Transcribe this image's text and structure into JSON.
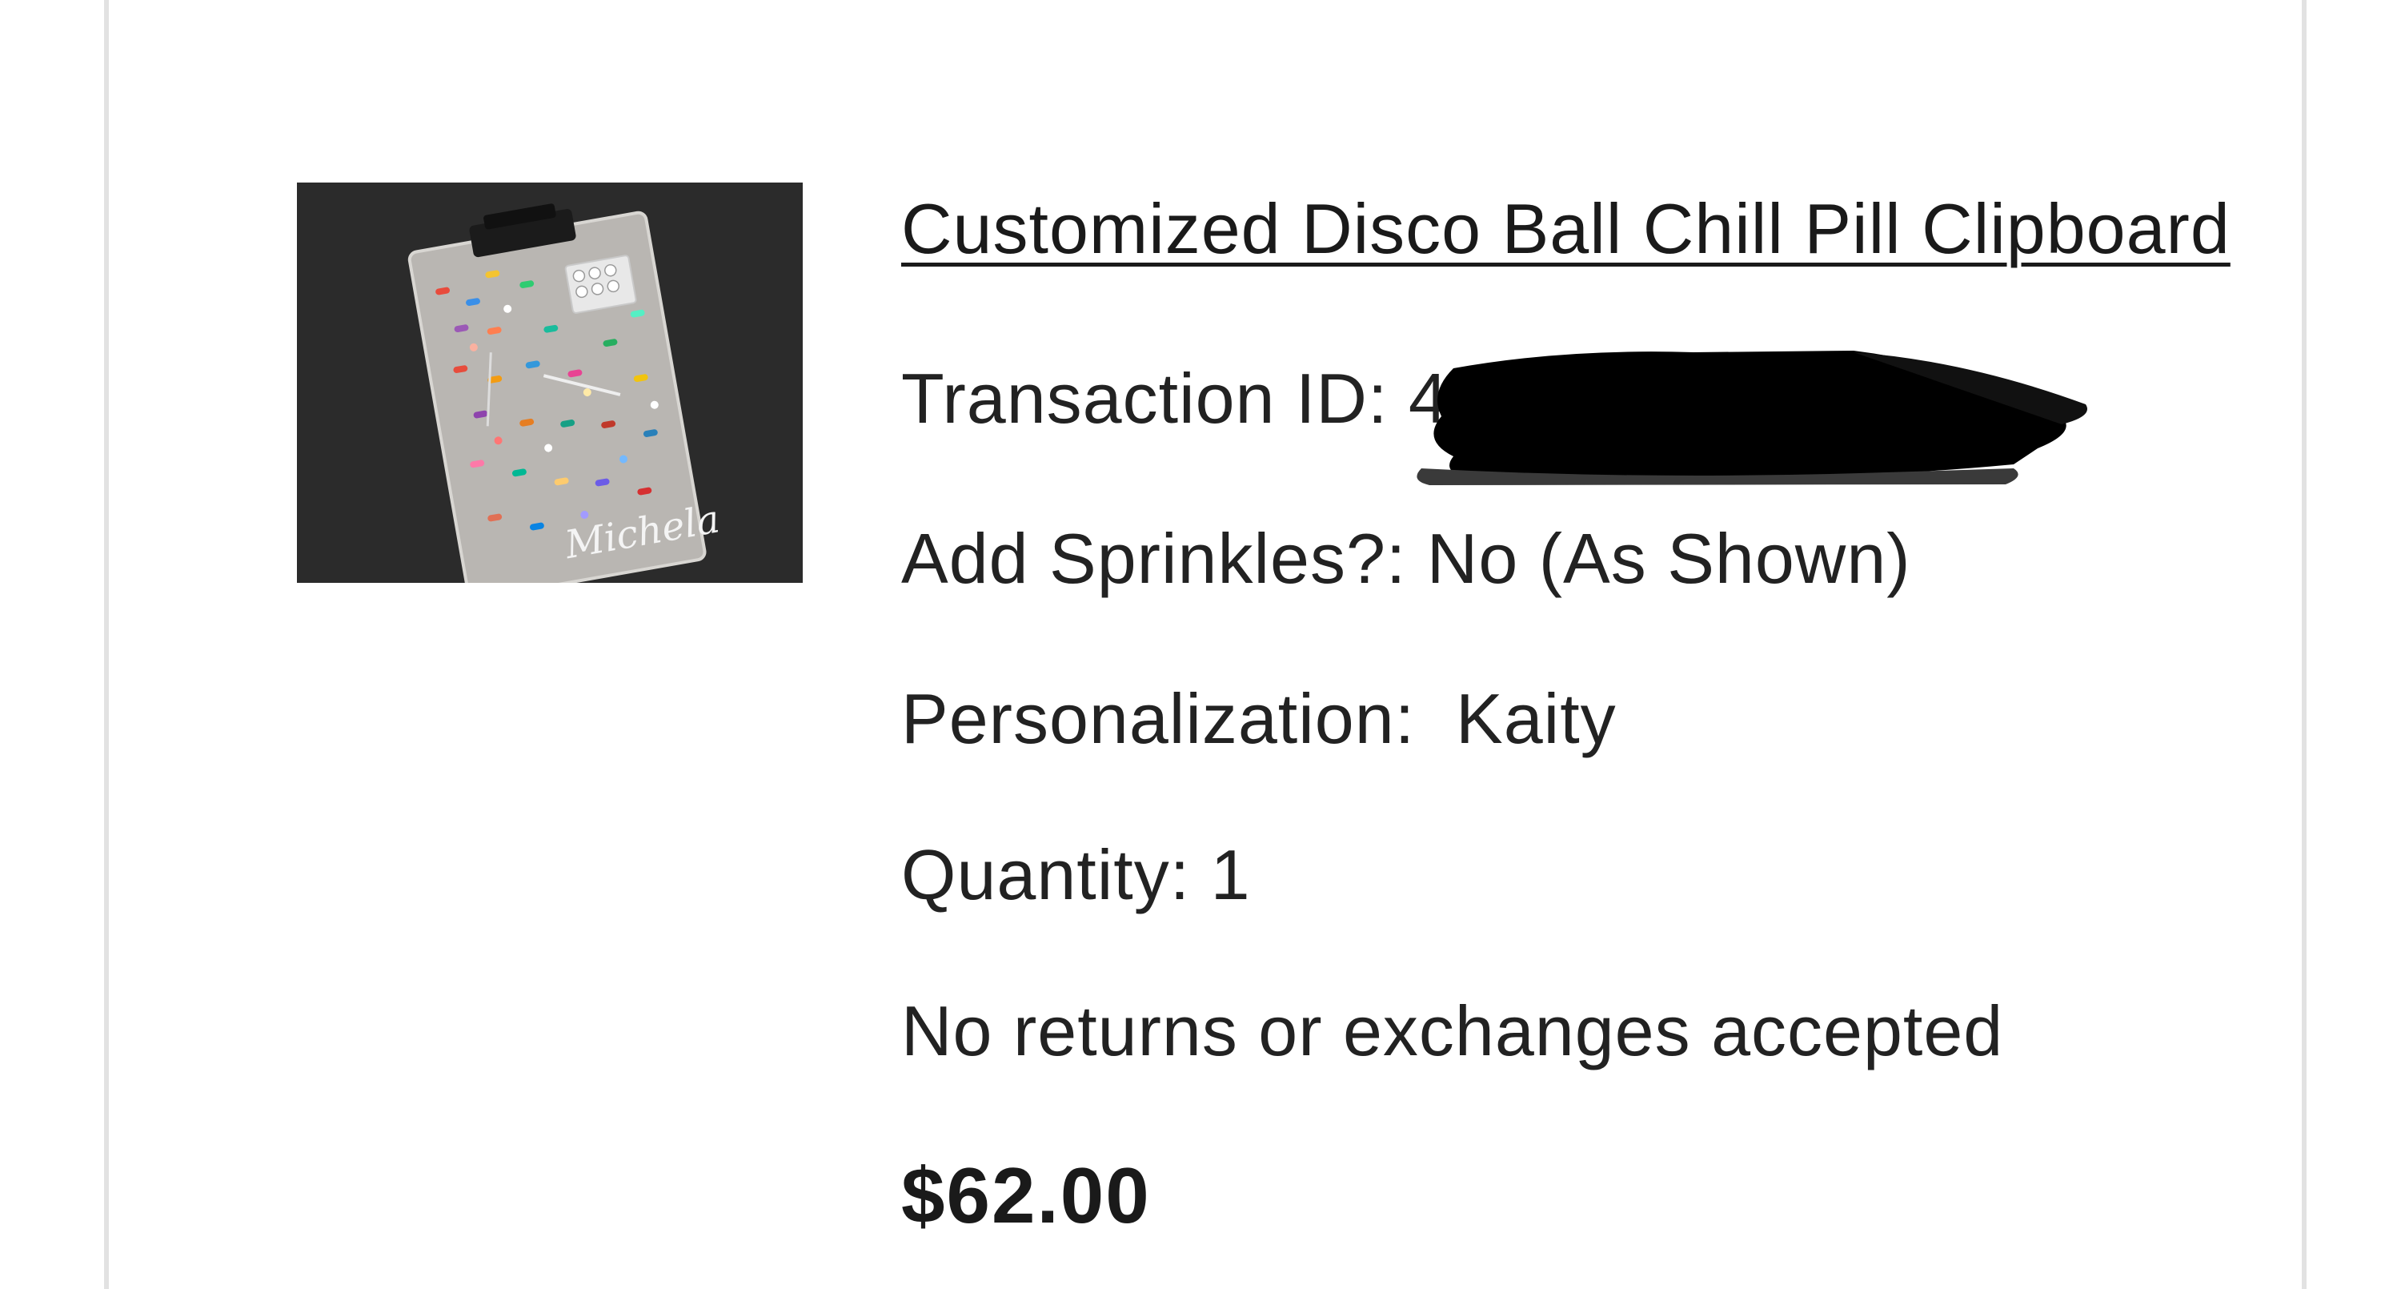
{
  "item": {
    "title": "Customized Disco Ball Chill Pill Clipboard",
    "transaction_label": "Transaction ID:",
    "transaction_value_visible": "40",
    "option_label": "Add Sprinkles?:",
    "option_value": "No (As Shown)",
    "personalization_label": "Personalization:",
    "personalization_value": "Kaity",
    "quantity_label": "Quantity:",
    "quantity_value": "1",
    "returns_policy": "No returns or exchanges accepted",
    "price": "$62.00",
    "thumbnail_signature": "Michela"
  },
  "colors": {
    "card_border": "#e2e2e2",
    "text": "#222222",
    "thumbnail_background": "#2c2c2c",
    "redaction": "#000000"
  }
}
